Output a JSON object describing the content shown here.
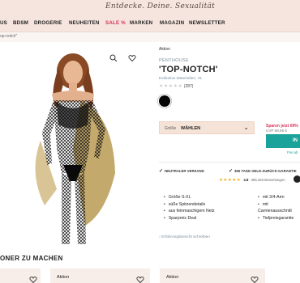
{
  "header": {
    "slogan": "Entdecke. Deine. Sexualität"
  },
  "nav": {
    "items": [
      {
        "label": "US",
        "sale": false
      },
      {
        "label": "BDSM",
        "sale": false
      },
      {
        "label": "DROGERIE",
        "sale": false
      },
      {
        "label": "NEUHEITEN",
        "sale": false
      },
      {
        "label": "SALE %",
        "sale": true
      },
      {
        "label": "MARKEN",
        "sale": false
      },
      {
        "label": "MAGAZIN",
        "sale": false
      },
      {
        "label": "NEWSLETTER",
        "sale": false
      }
    ]
  },
  "breadcrumb": {
    "current": "op-notch\""
  },
  "product": {
    "badge": "Aktion",
    "brand": "PENTHOUSE",
    "title": "'TOP-NOTCH'",
    "subtitle": "Exklusive Materialien, XL",
    "rating_count": "(287)",
    "swatch_color": "#050505",
    "size_label": "Größe",
    "size_value": "WÄHLEN",
    "price_note": "Sparen jetzt 69%",
    "uvp": "UVP 68,95 €",
    "cart_label": "IN",
    "cart_sub": "Frei ab"
  },
  "trust": {
    "shipping": "NEUTRALER VERSAND",
    "guarantee": "365 TAGE GELD-ZURÜCK-GARANTIE",
    "score": "4.8",
    "reviews": "395.460 Bewertungen"
  },
  "features": {
    "left": [
      "Größe S-XL",
      "süße Spitzendetails",
      "aus feinmaschigem Netz",
      "Sparpreis Deal"
    ],
    "right": [
      "mit 3/4-Arm",
      "mit Carmenausschnitt",
      "Tiefpreisgarantie"
    ]
  },
  "review_link": "Erfahrungsbericht schreiben",
  "recommendations": {
    "title": "ONER ZU MACHEN",
    "cards": [
      {
        "label": ""
      },
      {
        "label": "Aktion"
      },
      {
        "label": "Aktion"
      }
    ]
  },
  "colors": {
    "header_bg": "#f6e5de",
    "accent": "#1aa39a",
    "sale": "#d8325a"
  }
}
